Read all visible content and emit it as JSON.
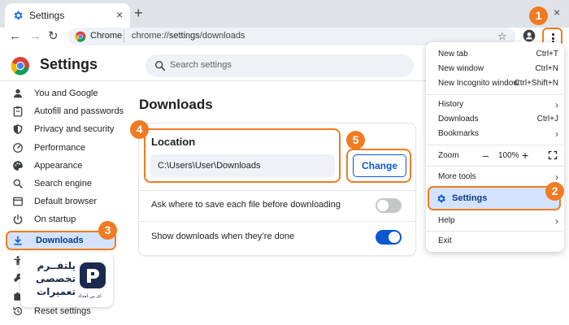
{
  "tab": {
    "title": "Settings",
    "close": "×",
    "new_tab": "+"
  },
  "window": {
    "close": "×"
  },
  "toolbar": {
    "back": "←",
    "forward": "→",
    "reload": "↻",
    "site_chip": "Chrome",
    "url_scheme": "chrome://",
    "url_host": "settings",
    "url_path": "/downloads",
    "bookmark": "☆"
  },
  "header": {
    "title": "Settings",
    "search_placeholder": "Search settings"
  },
  "sidebar": {
    "items": [
      {
        "label": "You and Google",
        "icon": "person-icon"
      },
      {
        "label": "Autofill and passwords",
        "icon": "clipboard-icon"
      },
      {
        "label": "Privacy and security",
        "icon": "shield-icon"
      },
      {
        "label": "Performance",
        "icon": "speedometer-icon"
      },
      {
        "label": "Appearance",
        "icon": "palette-icon"
      },
      {
        "label": "Search engine",
        "icon": "search-icon"
      },
      {
        "label": "Default browser",
        "icon": "browser-icon"
      },
      {
        "label": "On startup",
        "icon": "power-icon"
      },
      {
        "label": "Downloads",
        "icon": "download-icon",
        "active": true
      },
      {
        "label": "Reset settings",
        "icon": "reset-icon"
      }
    ]
  },
  "main": {
    "title": "Downloads",
    "location_label": "Location",
    "location_value": "C:\\Users\\User\\Downloads",
    "change_button": "Change",
    "ask_where_label": "Ask where to save each file before downloading",
    "ask_where_enabled": false,
    "show_downloads_label": "Show downloads when they’re done",
    "show_downloads_enabled": true
  },
  "menu": {
    "new_tab": {
      "label": "New tab",
      "shortcut": "Ctrl+T"
    },
    "new_window": {
      "label": "New window",
      "shortcut": "Ctrl+N"
    },
    "incognito": {
      "label": "New Incognito window",
      "shortcut": "Ctrl+Shift+N"
    },
    "history": {
      "label": "History",
      "arrow": "›"
    },
    "downloads": {
      "label": "Downloads",
      "shortcut": "Ctrl+J"
    },
    "bookmarks": {
      "label": "Bookmarks",
      "arrow": "›"
    },
    "zoom": {
      "label": "Zoom",
      "minus": "–",
      "value": "100%",
      "plus": "+"
    },
    "more_tools": {
      "label": "More tools",
      "arrow": "›"
    },
    "settings": {
      "label": "Settings"
    },
    "help": {
      "label": "Help",
      "arrow": "›"
    },
    "exit": {
      "label": "Exit"
    }
  },
  "steps": [
    "1",
    "2",
    "3",
    "4",
    "5"
  ],
  "logo": {
    "line1": "پلتفــرم",
    "line2": "تخصصی",
    "line3": "تعمیرات",
    "brand": "ای پی امداد"
  },
  "colors": {
    "accent_orange": "#f07b22",
    "chrome_blue": "#0b57d0",
    "active_bg": "#d3e3fd"
  }
}
